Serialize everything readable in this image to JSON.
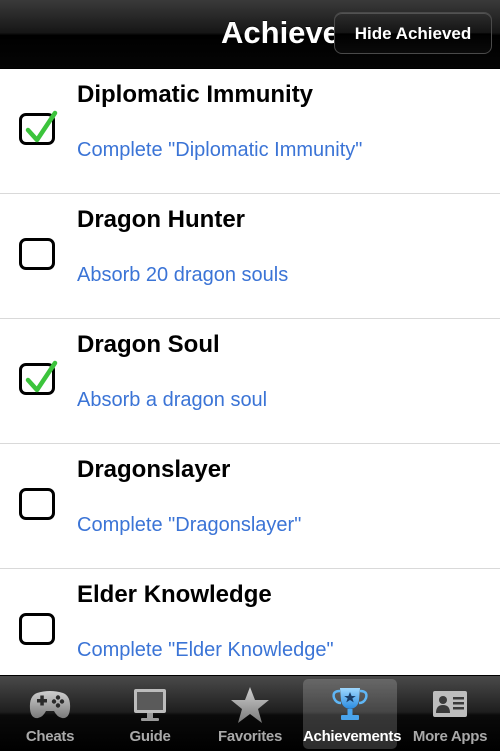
{
  "header": {
    "title": "Achievements",
    "hide_button_label": "Hide Achieved"
  },
  "achievements": [
    {
      "title": "Diplomatic Immunity",
      "description": "Complete \"Diplomatic Immunity\"",
      "achieved": true
    },
    {
      "title": "Dragon Hunter",
      "description": "Absorb 20 dragon souls",
      "achieved": false
    },
    {
      "title": "Dragon Soul",
      "description": "Absorb a dragon soul",
      "achieved": true
    },
    {
      "title": "Dragonslayer",
      "description": "Complete \"Dragonslayer\"",
      "achieved": false
    },
    {
      "title": "Elder Knowledge",
      "description": "Complete \"Elder Knowledge\"",
      "achieved": false
    }
  ],
  "tabs": [
    {
      "label": "Cheats",
      "icon": "gamepad-icon",
      "active": false
    },
    {
      "label": "Guide",
      "icon": "monitor-icon",
      "active": false
    },
    {
      "label": "Favorites",
      "icon": "star-icon",
      "active": false
    },
    {
      "label": "Achievements",
      "icon": "trophy-icon",
      "active": true
    },
    {
      "label": "More Apps",
      "icon": "contact-card-icon",
      "active": false
    }
  ],
  "colors": {
    "description_text": "#3b74d6",
    "check_green": "#3cc43c"
  }
}
